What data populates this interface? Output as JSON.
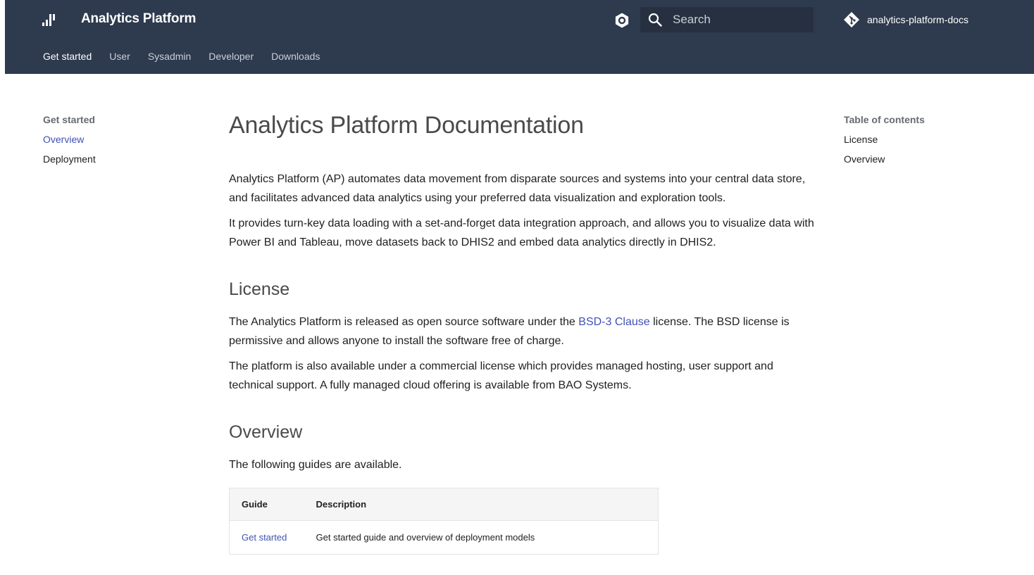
{
  "header": {
    "site_title": "Analytics Platform",
    "search_placeholder": "Search",
    "repo_name": "analytics-platform-docs",
    "tabs": [
      {
        "label": "Get started",
        "active": true
      },
      {
        "label": "User"
      },
      {
        "label": "Sysadmin"
      },
      {
        "label": "Developer"
      },
      {
        "label": "Downloads"
      }
    ]
  },
  "left_nav": {
    "heading": "Get started",
    "items": [
      {
        "label": "Overview",
        "active": true
      },
      {
        "label": "Deployment"
      }
    ]
  },
  "toc": {
    "heading": "Table of contents",
    "items": [
      {
        "label": "License"
      },
      {
        "label": "Overview"
      }
    ]
  },
  "main": {
    "title": "Analytics Platform Documentation",
    "intro_p1": "Analytics Platform (AP) automates data movement from disparate sources and systems into your central data store, and facilitates advanced data analytics using your preferred data visualization and exploration tools.",
    "intro_p2": "It provides turn-key data loading with a set-and-forget data integration approach, and allows you to visualize data with Power BI and Tableau, move datasets back to DHIS2 and embed data analytics directly in DHIS2.",
    "license_heading": "License",
    "license_p1_before": "The Analytics Platform is released as open source software under the ",
    "license_p1_link": "BSD-3 Clause",
    "license_p1_after": " license. The BSD license is permissive and allows anyone to install the software free of charge.",
    "license_p2": "The platform is also available under a commercial license which provides managed hosting, user support and technical support. A fully managed cloud offering is available from BAO Systems.",
    "overview_heading": "Overview",
    "overview_p": "The following guides are available.",
    "table": {
      "headers": [
        "Guide",
        "Description"
      ],
      "rows": [
        {
          "guide": "Get started",
          "description": "Get started guide and overview of deployment models"
        }
      ]
    }
  },
  "colors": {
    "header_bg": "#2e3a4d",
    "link": "#3f51b5"
  },
  "icons": {
    "logo": "bar-chart-logo-icon",
    "palette": "palette-toggle-icon",
    "search": "search-icon",
    "repo": "git-icon"
  }
}
